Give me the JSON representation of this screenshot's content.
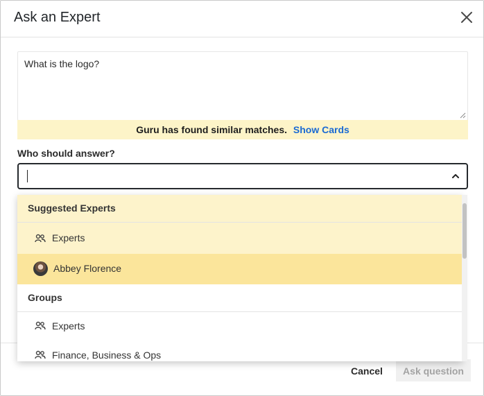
{
  "dialog": {
    "title": "Ask an Expert",
    "close_icon": "close-icon"
  },
  "question": {
    "value": "What is the logo?"
  },
  "notice": {
    "message": "Guru has found similar matches.",
    "link": "Show Cards",
    "background": "#fdf4c8",
    "link_color": "#1a6ad3"
  },
  "who": {
    "label": "Who should answer?",
    "value": ""
  },
  "dropdown": {
    "suggested_header": "Suggested Experts",
    "suggested_items": [
      {
        "label": "Experts",
        "icon": "group-icon"
      },
      {
        "label": "Abbey Florence",
        "icon": "avatar"
      }
    ],
    "groups_header": "Groups",
    "group_items": [
      {
        "label": "Experts",
        "icon": "group-icon"
      },
      {
        "label": "Finance, Business & Ops",
        "icon": "group-icon"
      }
    ],
    "highlight_light": "#fdf3cb",
    "highlight_strong": "#fbe59b"
  },
  "footer": {
    "cancel_label": "Cancel",
    "ask_label": "Ask question"
  }
}
